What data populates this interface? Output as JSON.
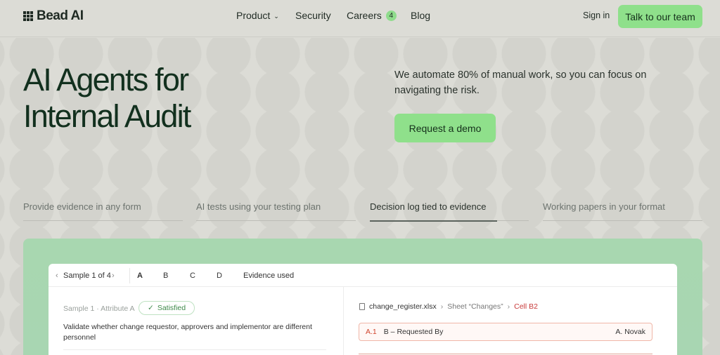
{
  "nav": {
    "logo": "Bead AI",
    "links": [
      {
        "label": "Product",
        "has_dropdown": true
      },
      {
        "label": "Security"
      },
      {
        "label": "Careers",
        "badge": "4"
      },
      {
        "label": "Blog"
      }
    ],
    "signin": "Sign in",
    "cta": "Talk to our team"
  },
  "hero": {
    "title_line1": "AI Agents for",
    "title_line2": "Internal Audit",
    "subtitle": "We automate 80% of manual work, so you can focus on navigating the risk.",
    "cta": "Request a demo"
  },
  "features": [
    {
      "label": "Provide evidence in any form"
    },
    {
      "label": "AI tests using your testing plan"
    },
    {
      "label": "Decision log tied to evidence",
      "active": true,
      "progress": 0.8
    },
    {
      "label": "Working papers in your format"
    }
  ],
  "demo": {
    "sample_nav": "Sample 1 of 4",
    "tabs": [
      "A",
      "B",
      "C",
      "D",
      "Evidence used"
    ],
    "active_tab": "A",
    "sample_label": "Sample 1 · Attribute A",
    "status": "Satisfied",
    "description": "Validate whether change requestor, approvers and implementor are different personnel",
    "file": "change_register.xlsx",
    "sheet": "Sheet “Changes”",
    "cell": "Cell B2",
    "row_id": "A.1",
    "row_label": "B – Requested By",
    "row_value": "A. Novak"
  },
  "colors": {
    "accent": "#8fe08b",
    "background": "#dcdcd6",
    "title": "#12301e",
    "panel": "#a8d7b0",
    "error_red": "#c83a3a"
  }
}
